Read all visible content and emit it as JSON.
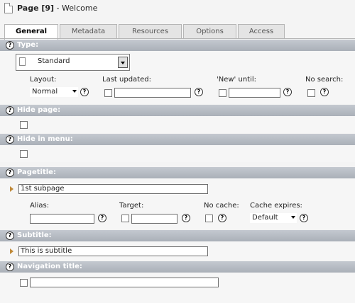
{
  "header": {
    "page_label": "Page [9]",
    "page_title": " - Welcome"
  },
  "tabs": [
    "General",
    "Metadata",
    "Resources",
    "Options",
    "Access"
  ],
  "help_glyph": "?",
  "sections": {
    "type": {
      "title": "Type:",
      "value": "Standard",
      "layout_label": "Layout:",
      "layout_value": "Normal",
      "last_updated_label": "Last updated:",
      "new_until_label": "'New' until:",
      "no_search_label": "No search:"
    },
    "hide_page": {
      "title": "Hide page:"
    },
    "hide_in_menu": {
      "title": "Hide in menu:"
    },
    "pagetitle": {
      "title": "Pagetitle:",
      "value": "1st subpage",
      "alias_label": "Alias:",
      "target_label": "Target:",
      "no_cache_label": "No cache:",
      "cache_expires_label": "Cache expires:",
      "cache_expires_value": "Default"
    },
    "subtitle": {
      "title": "Subtitle:",
      "value": "This is subtitle"
    },
    "nav_title": {
      "title": "Navigation title:"
    }
  }
}
